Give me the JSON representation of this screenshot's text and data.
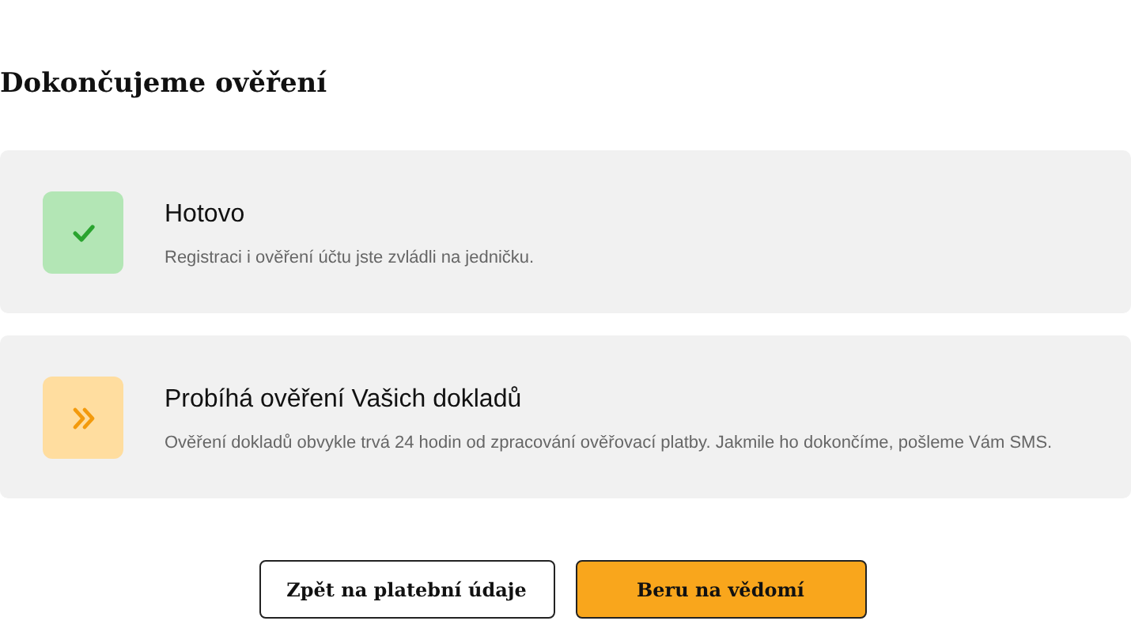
{
  "heading": "Dokončujeme ověření",
  "steps": [
    {
      "kind": "done",
      "title": "Hotovo",
      "description": "Registraci i ověření účtu jste zvládli na jedničku."
    },
    {
      "kind": "in_progress",
      "title": "Probíhá ověření Vašich dokladů",
      "description": "Ověření dokladů obvykle trvá 24 hodin od zpracování ověřovací platby. Jakmile ho dokončíme, pošleme Vám SMS."
    }
  ],
  "buttons": [
    {
      "label": "Zpět na platební údaje",
      "kind": "secondary"
    },
    {
      "label": "Beru na vědomí",
      "kind": "primary"
    }
  ]
}
